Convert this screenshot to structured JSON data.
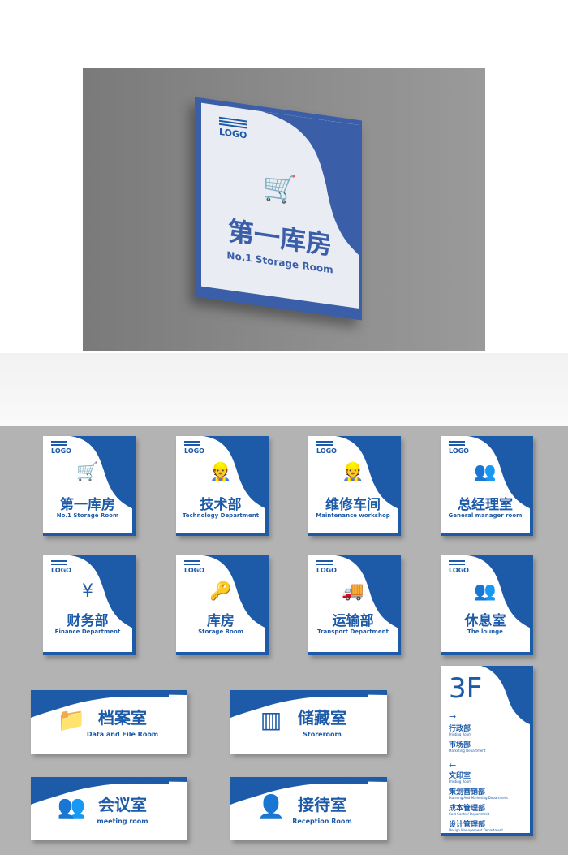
{
  "brand_color": "#1d5aa8",
  "hero": {
    "logo": "LOGO",
    "icon": "person-pushing-cart-icon",
    "title_cn": "第一库房",
    "title_en": "No.1 Storage Room"
  },
  "square_signs": [
    {
      "logo": "LOGO",
      "icon": "cart-icon",
      "glyph": "🛒",
      "cn": "第一库房",
      "en": "No.1 Storage Room"
    },
    {
      "logo": "LOGO",
      "icon": "worker-icon",
      "glyph": "👷",
      "cn": "技术部",
      "en": "Technology Department"
    },
    {
      "logo": "LOGO",
      "icon": "engineer-icon",
      "glyph": "👷",
      "cn": "维修车间",
      "en": "Maintenance workshop"
    },
    {
      "logo": "LOGO",
      "icon": "manager-icon",
      "glyph": "👥",
      "cn": "总经理室",
      "en": "General manager room"
    },
    {
      "logo": "LOGO",
      "icon": "money-icon",
      "glyph": "¥",
      "cn": "财务部",
      "en": "Finance Department"
    },
    {
      "logo": "LOGO",
      "icon": "key-icon",
      "glyph": "🔑",
      "cn": "库房",
      "en": "Storage Room"
    },
    {
      "logo": "LOGO",
      "icon": "truck-icon",
      "glyph": "🚚",
      "cn": "运输部",
      "en": "Transport Department"
    },
    {
      "logo": "LOGO",
      "icon": "lounge-icon",
      "glyph": "👥",
      "cn": "休息室",
      "en": "The lounge"
    }
  ],
  "wide_signs": [
    {
      "icon": "folder-icon",
      "glyph": "📁",
      "cn": "档案室",
      "en": "Data and File Room"
    },
    {
      "icon": "shelf-icon",
      "glyph": "▥",
      "cn": "储藏室",
      "en": "Storeroom"
    },
    {
      "icon": "meeting-icon",
      "glyph": "👥",
      "cn": "会议室",
      "en": "meeting room"
    },
    {
      "icon": "reception-icon",
      "glyph": "👤",
      "cn": "接待室",
      "en": "Reception Room"
    }
  ],
  "directory": {
    "floor": "3F",
    "right_arrow": "→",
    "right": [
      {
        "cn": "行政部",
        "en": "Printing Room"
      },
      {
        "cn": "市场部",
        "en": "Marketing Department"
      }
    ],
    "left_arrow": "←",
    "left": [
      {
        "cn": "文印室",
        "en": "Printing Room"
      },
      {
        "cn": "策划营销部",
        "en": "Planning And Marketing Department"
      },
      {
        "cn": "成本管理部",
        "en": "Cost Control Department"
      },
      {
        "cn": "设计管理部",
        "en": "Design Management Department"
      }
    ]
  }
}
